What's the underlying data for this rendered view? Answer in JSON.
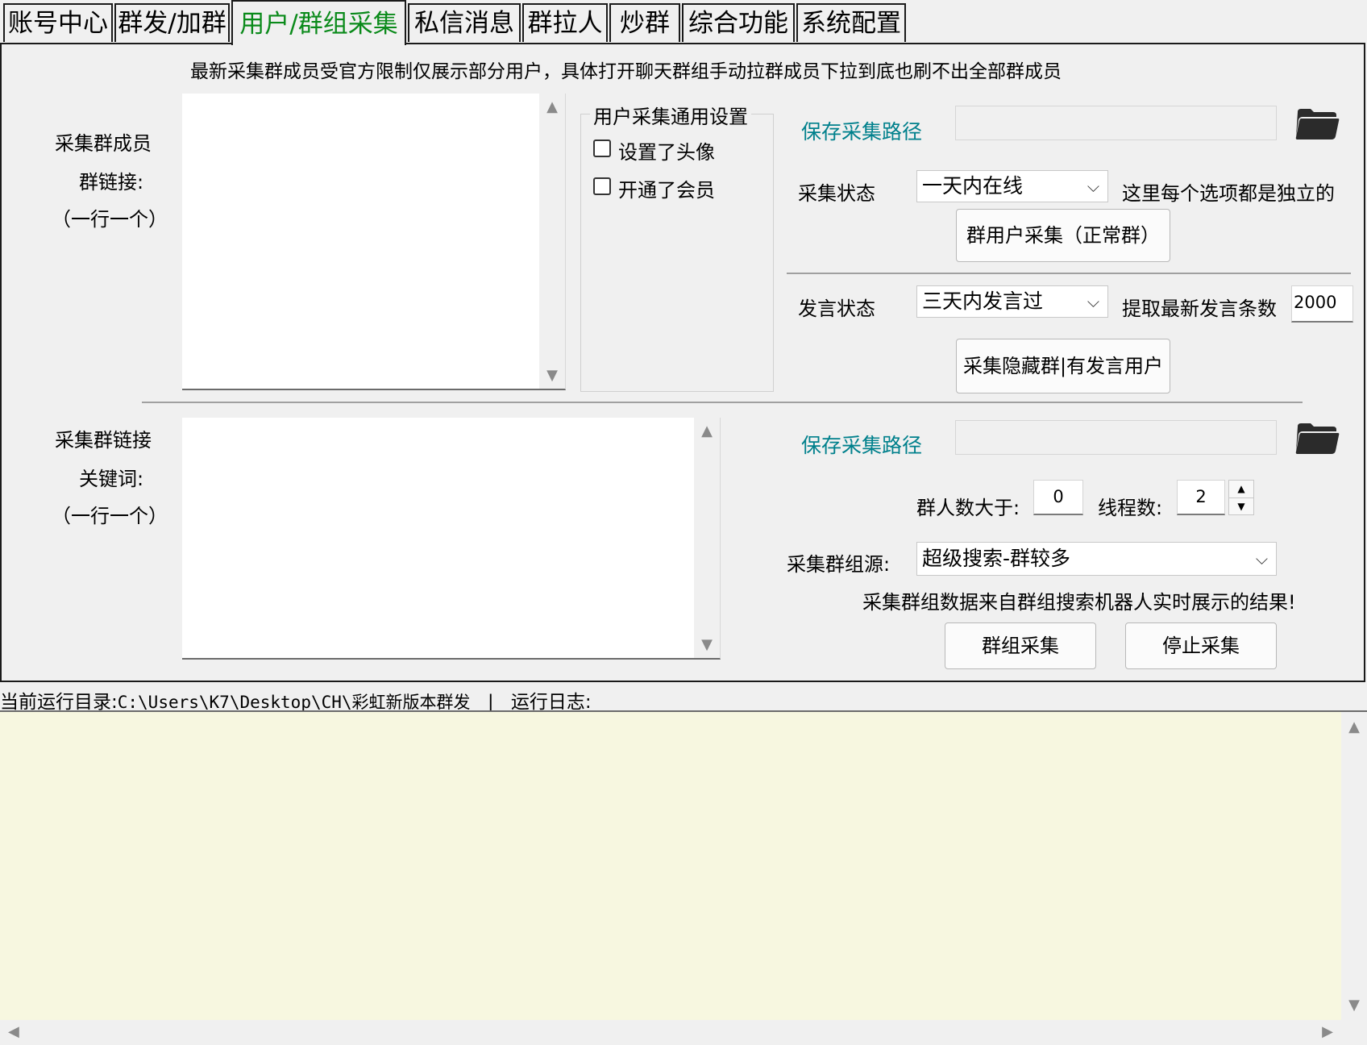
{
  "tabs": [
    "账号中心",
    "群发/加群",
    "用户/群组采集",
    "私信消息",
    "群拉人",
    "炒群",
    "综合功能",
    "系统配置"
  ],
  "notice": "最新采集群成员受官方限制仅展示部分用户，具体打开聊天群组手动拉群成员下拉到底也刷不出全部群成员",
  "member_section": {
    "label_line1": "采集群成员",
    "label_line2": "群链接:",
    "label_line3": "（一行一个）",
    "settings_title": "用户采集通用设置",
    "checkbox_avatar": "设置了头像",
    "checkbox_vip": "开通了会员",
    "save_path_label": "保存采集路径",
    "save_path_value": "",
    "status_label": "采集状态",
    "status_value": "一天内在线",
    "independent_note": "这里每个选项都是独立的",
    "collect_button": "群用户采集（正常群）",
    "speak_label": "发言状态",
    "speak_value": "三天内发言过",
    "latest_count_label": "提取最新发言条数",
    "latest_count_value": "2000",
    "hidden_button": "采集隐藏群|有发言用户"
  },
  "group_section": {
    "label_line1": "采集群链接",
    "label_line2": "关键词:",
    "label_line3": "（一行一个）",
    "save_path_label": "保存采集路径",
    "save_path_value": "",
    "members_gt_label": "群人数大于:",
    "members_gt_value": "0",
    "threads_label": "线程数:",
    "threads_value": "2",
    "source_label": "采集群组源:",
    "source_value": "超级搜索-群较多",
    "source_note": "采集群组数据来自群组搜索机器人实时展示的结果!",
    "collect_button": "群组采集",
    "stop_button": "停止采集"
  },
  "status_bar": {
    "dir_label": "当前运行目录:",
    "dir_value": "C:\\Users\\K7\\Desktop\\CH\\彩虹新版本群发",
    "separator": "|",
    "log_label": "运行日志:"
  },
  "colors": {
    "active_tab": "#0a8a1a",
    "teal_label": "#00808c",
    "log_bg": "#f7f7e0"
  }
}
